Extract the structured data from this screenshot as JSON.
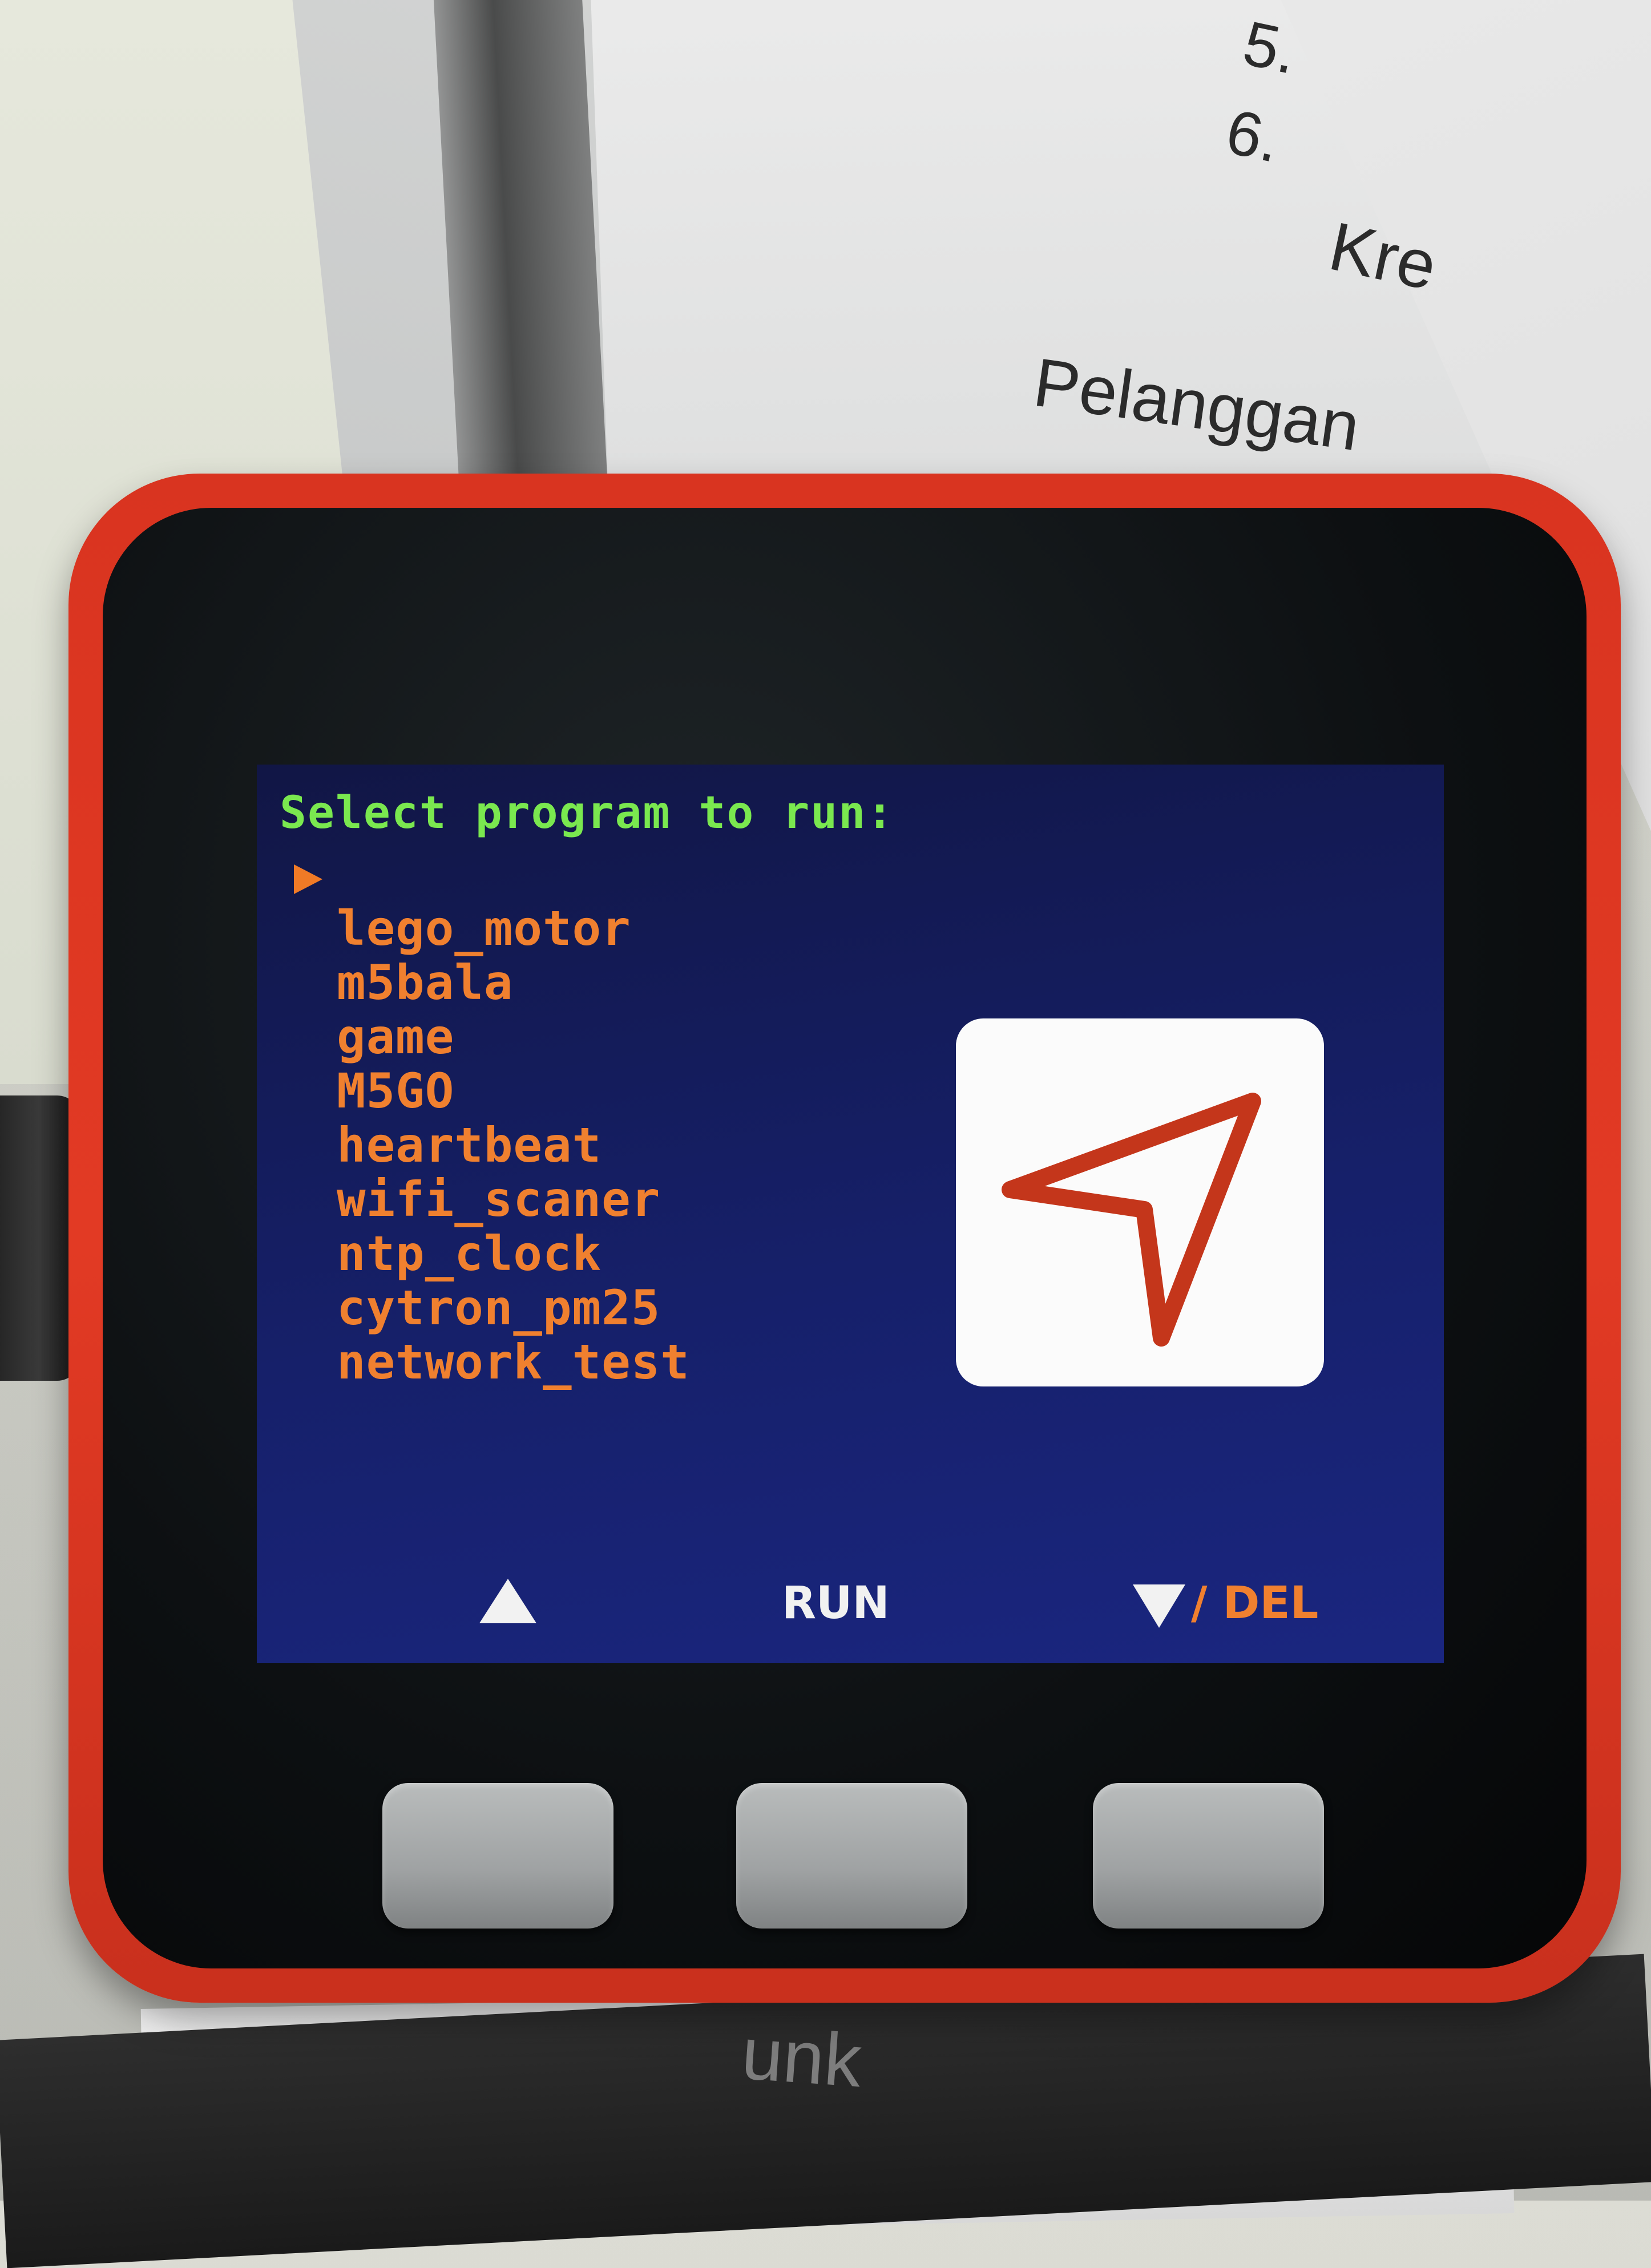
{
  "background": {
    "paper_labels": [
      "5.",
      "6.",
      "Kre",
      "Pelanggan",
      "unk"
    ]
  },
  "screen": {
    "title": "Select program to run:",
    "programs": [
      "lego_motor",
      "m5bala",
      "game",
      "M5GO",
      "heartbeat",
      "wifi_scaner",
      "ntp_clock",
      "cytron_pm25",
      "network_test"
    ],
    "selected_index": 0,
    "preview_icon": "navigation-arrow-icon",
    "softkeys": {
      "up_icon": "triangle-up-icon",
      "run_label": "RUN",
      "del_icon": "triangle-down-icon",
      "del_label": "/ DEL"
    },
    "colors": {
      "title": "#7ae84f",
      "program_text": "#f0802f",
      "background": "#16206a",
      "device_shell": "#e23a24"
    }
  }
}
